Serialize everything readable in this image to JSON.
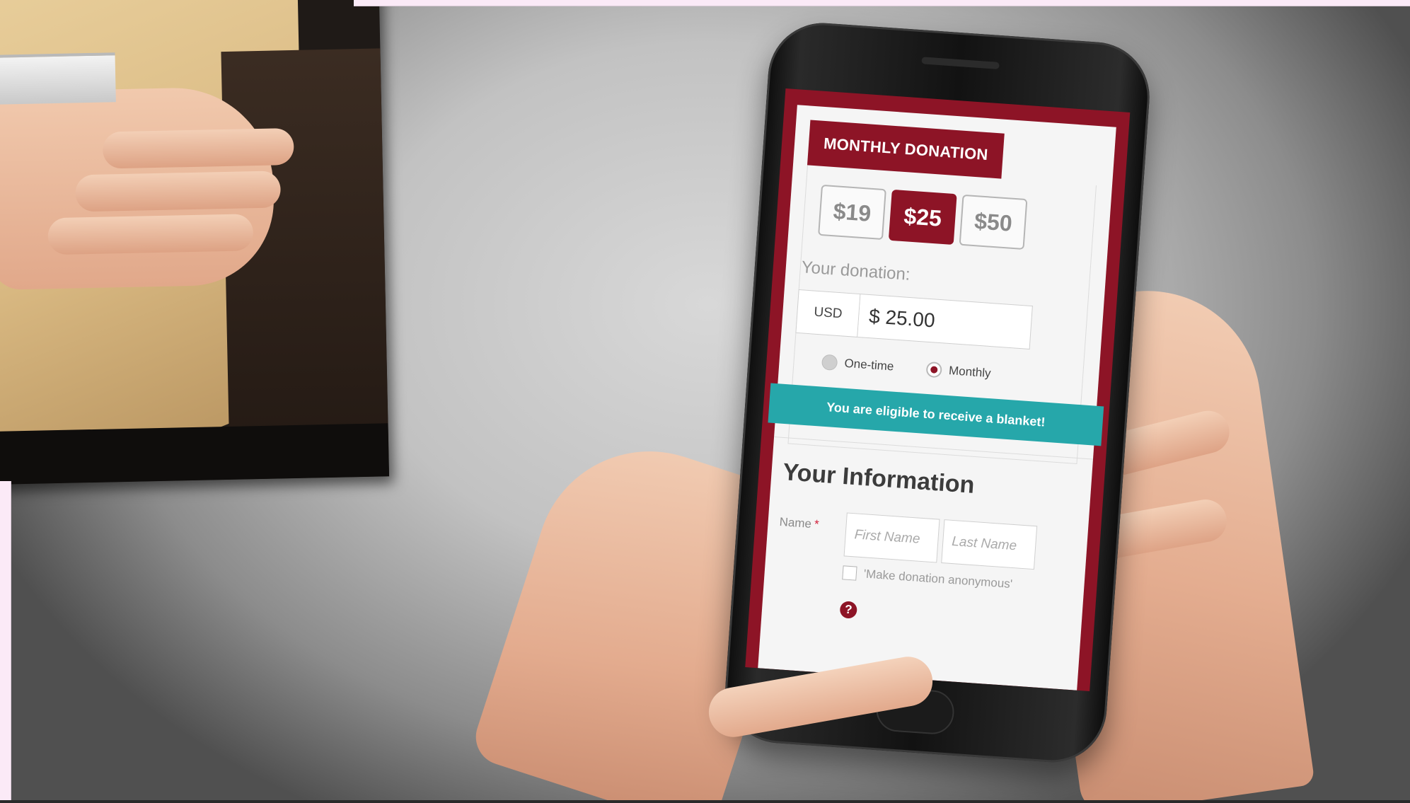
{
  "donation_form": {
    "tab_label": "MONTHLY DONATION",
    "amounts": [
      {
        "label": "$19",
        "selected": false
      },
      {
        "label": "$25",
        "selected": true
      },
      {
        "label": "$50",
        "selected": false
      }
    ],
    "your_donation_label": "Your donation:",
    "currency": "USD",
    "amount_value": "$ 25.00",
    "frequency_options": [
      {
        "label": "One-time",
        "checked": false
      },
      {
        "label": "Monthly",
        "checked": true
      }
    ],
    "eligibility_banner": "You are eligible to receive a blanket!"
  },
  "your_information": {
    "title": "Your Information",
    "name_label": "Name",
    "required_mark": "*",
    "first_name_placeholder": "First Name",
    "last_name_placeholder": "Last Name",
    "anonymous_label": "'Make donation anonymous'",
    "help_glyph": "?"
  },
  "colors": {
    "brand_maroon": "#8d1426",
    "banner_teal": "#26a7aa",
    "frame_pink": "#fbeaf7"
  },
  "icons": [
    "help-icon",
    "radio-icon",
    "checkbox-icon"
  ]
}
